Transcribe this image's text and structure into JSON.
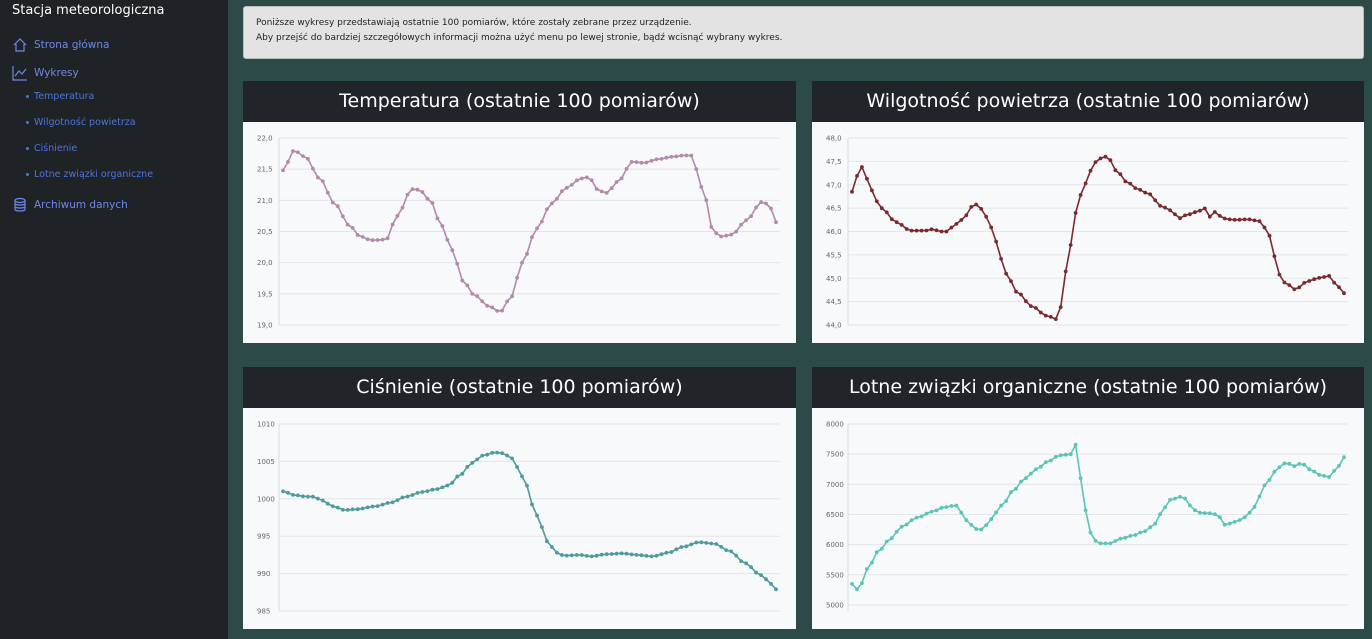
{
  "sidebar": {
    "title": "Stacja meteorologiczna",
    "items": [
      {
        "label": "Strona główna",
        "icon": "house-icon"
      },
      {
        "label": "Wykresy",
        "icon": "chart-line-icon"
      },
      {
        "label": "Archiwum danych",
        "icon": "database-icon"
      }
    ],
    "sub_items": [
      {
        "label": "Temperatura"
      },
      {
        "label": "Wilgotność powietrza"
      },
      {
        "label": "Ciśnienie"
      },
      {
        "label": "Lotne związki organiczne"
      }
    ]
  },
  "info": {
    "line1": "Poniższe wykresy przedstawiają ostatnie 100 pomiarów, które zostały zebrane przez urządzenie.",
    "line2": "Aby przejść do bardziej szczegółowych informacji można użyć menu po lewej stronie, bądź wcisnąć wybrany wykres."
  },
  "colors": {
    "sidebar": "#1f2326",
    "background": "#2c4a48",
    "link": "#4b74e0"
  },
  "chart_data": [
    {
      "type": "line",
      "title": "Temperatura (ostatnie 100 pomiarów)",
      "color": "#b48aa8",
      "ylim": [
        19.0,
        22.0
      ],
      "yticks": [
        "19,0",
        "19,5",
        "20,0",
        "20,5",
        "21,0",
        "21,5",
        "22,0"
      ],
      "anchors": [
        [
          0,
          21.48
        ],
        [
          3,
          21.8
        ],
        [
          6,
          21.7
        ],
        [
          10,
          21.35
        ],
        [
          14,
          20.95
        ],
        [
          18,
          20.6
        ],
        [
          21,
          20.42
        ],
        [
          24,
          20.36
        ],
        [
          28,
          20.37
        ],
        [
          31,
          20.75
        ],
        [
          35,
          21.18
        ],
        [
          37,
          21.17
        ],
        [
          40,
          21.0
        ],
        [
          43,
          20.6
        ],
        [
          46,
          20.2
        ],
        [
          49,
          19.7
        ],
        [
          52,
          19.48
        ],
        [
          56,
          19.3
        ],
        [
          59,
          19.21
        ],
        [
          62,
          19.45
        ],
        [
          65,
          20.0
        ],
        [
          69,
          20.55
        ],
        [
          73,
          20.95
        ],
        [
          77,
          21.2
        ],
        [
          81,
          21.35
        ],
        [
          83,
          21.37
        ],
        [
          86,
          21.15
        ],
        [
          88,
          21.12
        ],
        [
          91,
          21.3
        ],
        [
          95,
          21.62
        ],
        [
          98,
          21.6
        ],
        [
          102,
          21.66
        ],
        [
          106,
          21.7
        ],
        [
          109,
          21.72
        ],
        [
          111,
          21.72
        ],
        [
          114,
          21.2
        ],
        [
          117,
          20.5
        ],
        [
          119,
          20.42
        ],
        [
          122,
          20.45
        ],
        [
          126,
          20.68
        ],
        [
          130,
          20.97
        ],
        [
          132,
          20.94
        ],
        [
          134,
          20.65
        ]
      ],
      "n": 100
    },
    {
      "type": "line",
      "title": "Wilgotność powietrza (ostatnie 100 pomiarów)",
      "color": "#7a2a2f",
      "ylim": [
        44.0,
        48.0
      ],
      "yticks": [
        "44,0",
        "44,5",
        "45,0",
        "45,5",
        "46,0",
        "46,5",
        "47,0",
        "47,5",
        "48,0"
      ],
      "anchors": [
        [
          0,
          46.85
        ],
        [
          2,
          47.3
        ],
        [
          3,
          47.4
        ],
        [
          5,
          46.9
        ],
        [
          8,
          46.5
        ],
        [
          12,
          46.2
        ],
        [
          16,
          46.02
        ],
        [
          20,
          46.02
        ],
        [
          22,
          46.05
        ],
        [
          24,
          46.0
        ],
        [
          26,
          46.0
        ],
        [
          28,
          46.15
        ],
        [
          30,
          46.25
        ],
        [
          33,
          46.55
        ],
        [
          34,
          46.58
        ],
        [
          37,
          46.3
        ],
        [
          39,
          45.8
        ],
        [
          42,
          45.1
        ],
        [
          45,
          44.7
        ],
        [
          49,
          44.4
        ],
        [
          53,
          44.2
        ],
        [
          56,
          44.12
        ],
        [
          57,
          44.4
        ],
        [
          59,
          45.55
        ],
        [
          61,
          46.4
        ],
        [
          63,
          46.95
        ],
        [
          65,
          47.3
        ],
        [
          67,
          47.55
        ],
        [
          69,
          47.6
        ],
        [
          70,
          47.55
        ],
        [
          72,
          47.3
        ],
        [
          75,
          47.05
        ],
        [
          78,
          46.9
        ],
        [
          81,
          46.8
        ],
        [
          84,
          46.55
        ],
        [
          87,
          46.45
        ],
        [
          89,
          46.28
        ],
        [
          91,
          46.35
        ],
        [
          94,
          46.42
        ],
        [
          96,
          46.5
        ],
        [
          97,
          46.3
        ],
        [
          99,
          46.42
        ],
        [
          101,
          46.28
        ],
        [
          104,
          46.25
        ],
        [
          108,
          46.26
        ],
        [
          111,
          46.22
        ],
        [
          114,
          45.9
        ],
        [
          116,
          45.1
        ],
        [
          118,
          44.9
        ],
        [
          121,
          44.75
        ],
        [
          123,
          44.9
        ],
        [
          126,
          44.98
        ],
        [
          128,
          45.02
        ],
        [
          130,
          45.05
        ],
        [
          132,
          44.85
        ],
        [
          134,
          44.68
        ]
      ],
      "n": 100
    },
    {
      "type": "line",
      "title": "Ciśnienie (ostatnie 100 pomiarów)",
      "color": "#4f9a9a",
      "ylim": [
        985,
        1010
      ],
      "yticks": [
        "985",
        "990",
        "995",
        "1000",
        "1005",
        "1010"
      ],
      "anchors": [
        [
          0,
          1001.0
        ],
        [
          3,
          1000.5
        ],
        [
          6,
          1000.3
        ],
        [
          8,
          1000.3
        ],
        [
          10,
          999.8
        ],
        [
          13,
          999.0
        ],
        [
          16,
          998.5
        ],
        [
          19,
          998.6
        ],
        [
          24,
          999.0
        ],
        [
          28,
          999.5
        ],
        [
          32,
          1000.3
        ],
        [
          36,
          1000.9
        ],
        [
          40,
          1001.3
        ],
        [
          43,
          1001.8
        ],
        [
          46,
          1003.2
        ],
        [
          49,
          1004.8
        ],
        [
          52,
          1005.8
        ],
        [
          55,
          1006.2
        ],
        [
          57,
          1006.1
        ],
        [
          59,
          1005.6
        ],
        [
          61,
          1004.2
        ],
        [
          63,
          1002.0
        ],
        [
          65,
          999.0
        ],
        [
          67,
          996.3
        ],
        [
          69,
          994.0
        ],
        [
          71,
          992.8
        ],
        [
          73,
          992.4
        ],
        [
          77,
          992.5
        ],
        [
          80,
          992.3
        ],
        [
          84,
          992.6
        ],
        [
          88,
          992.7
        ],
        [
          92,
          992.5
        ],
        [
          96,
          992.3
        ],
        [
          100,
          992.8
        ],
        [
          104,
          993.6
        ],
        [
          108,
          994.2
        ],
        [
          112,
          994.0
        ],
        [
          116,
          993.0
        ],
        [
          120,
          991.4
        ],
        [
          124,
          989.8
        ],
        [
          127,
          988.6
        ],
        [
          128,
          987.9
        ]
      ],
      "n": 100
    },
    {
      "type": "line",
      "title": "Lotne związki organiczne (ostatnie 100 pomiarów)",
      "color": "#5bc5b5",
      "ylim": [
        4900,
        8000
      ],
      "yticks": [
        "5000",
        "5500",
        "6000",
        "6500",
        "7000",
        "7500",
        "8000"
      ],
      "anchors": [
        [
          0,
          5350
        ],
        [
          1,
          5250
        ],
        [
          2,
          5300
        ],
        [
          4,
          5600
        ],
        [
          7,
          5900
        ],
        [
          10,
          6100
        ],
        [
          13,
          6300
        ],
        [
          17,
          6450
        ],
        [
          21,
          6550
        ],
        [
          24,
          6620
        ],
        [
          27,
          6650
        ],
        [
          30,
          6400
        ],
        [
          32,
          6260
        ],
        [
          34,
          6250
        ],
        [
          36,
          6420
        ],
        [
          39,
          6650
        ],
        [
          42,
          6900
        ],
        [
          45,
          7100
        ],
        [
          48,
          7250
        ],
        [
          51,
          7380
        ],
        [
          54,
          7480
        ],
        [
          57,
          7500
        ],
        [
          58,
          7680
        ],
        [
          59,
          7400
        ],
        [
          60,
          6750
        ],
        [
          62,
          6200
        ],
        [
          64,
          6020
        ],
        [
          67,
          6020
        ],
        [
          70,
          6100
        ],
        [
          73,
          6150
        ],
        [
          76,
          6220
        ],
        [
          79,
          6350
        ],
        [
          81,
          6600
        ],
        [
          83,
          6750
        ],
        [
          86,
          6800
        ],
        [
          88,
          6650
        ],
        [
          90,
          6530
        ],
        [
          93,
          6520
        ],
        [
          95,
          6500
        ],
        [
          97,
          6330
        ],
        [
          100,
          6380
        ],
        [
          102,
          6450
        ],
        [
          104,
          6550
        ],
        [
          106,
          6800
        ],
        [
          108,
          7050
        ],
        [
          111,
          7280
        ],
        [
          113,
          7360
        ],
        [
          115,
          7300
        ],
        [
          117,
          7350
        ],
        [
          119,
          7250
        ],
        [
          122,
          7150
        ],
        [
          124,
          7120
        ],
        [
          126,
          7250
        ],
        [
          128,
          7450
        ]
      ],
      "n": 100
    }
  ]
}
